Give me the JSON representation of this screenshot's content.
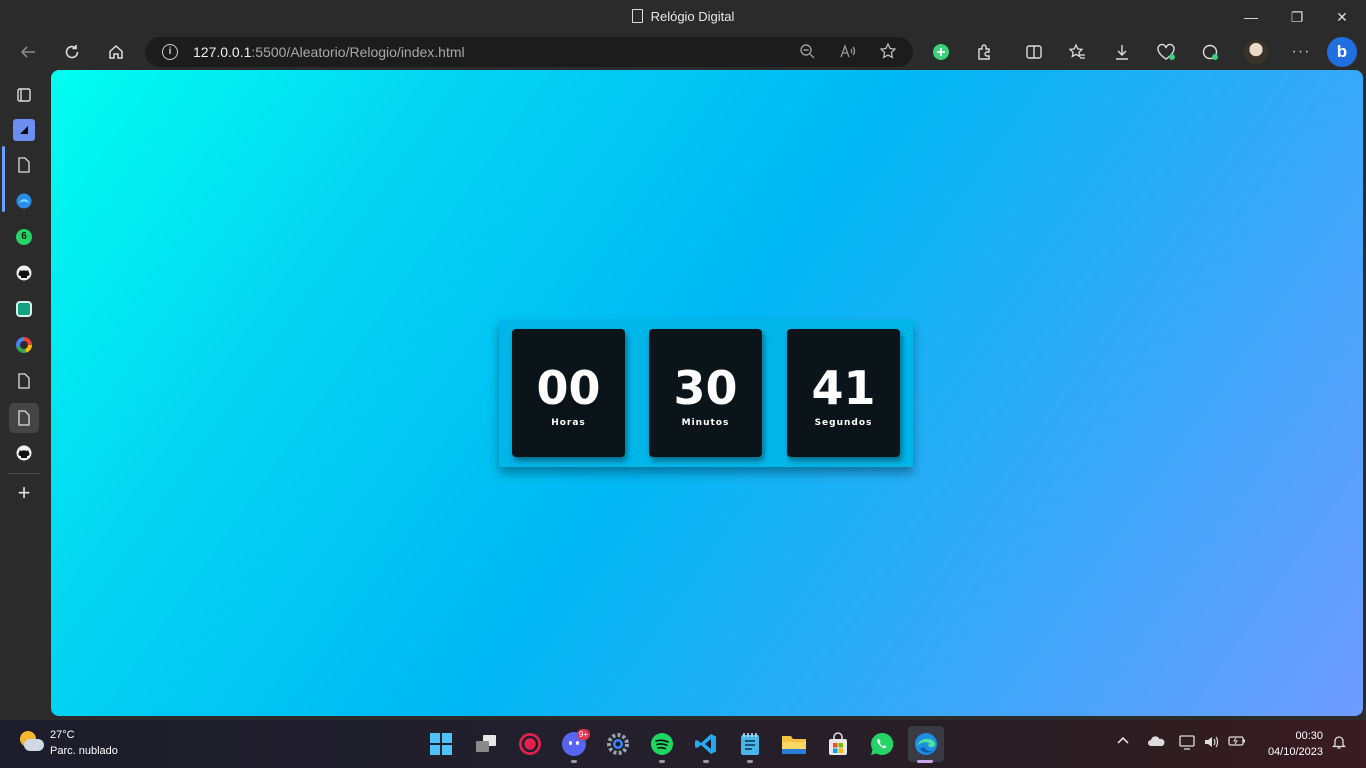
{
  "window": {
    "title": "Relógio Digital",
    "minimize_glyph": "—",
    "restore_glyph": "❐",
    "close_glyph": "✕"
  },
  "toolbar": {
    "url_host": "127.0.0.1",
    "url_rest": ":5500/Aleatorio/Relogio/index.html",
    "icons": [
      "back-icon",
      "refresh-icon",
      "home-icon",
      "info-icon",
      "zoom-out-icon",
      "read-aloud-icon",
      "favorite-star-icon",
      "add-icon",
      "extensions-icon",
      "split-screen-icon",
      "favorites-icon",
      "downloads-icon",
      "health-icon",
      "copilot-icon",
      "profile-avatar",
      "more-icon",
      "bing-icon"
    ]
  },
  "sidebar": {
    "items": [
      "tab-actions-icon",
      "tab-icon",
      "page-icon",
      "edge-tab-icon",
      "whatsapp-icon",
      "github-icon",
      "chatgpt-icon",
      "google-icon",
      "page-icon",
      "page-icon",
      "github-icon",
      "add-icon"
    ],
    "whatsapp_count": "6",
    "add_glyph": "+"
  },
  "clock": {
    "hours": "00",
    "hours_label": "Horas",
    "minutes": "30",
    "minutes_label": "Minutos",
    "seconds": "41",
    "seconds_label": "Segundos"
  },
  "taskbar": {
    "weather_temp": "27°C",
    "weather_condition": "Parc. nublado",
    "apps": [
      "windows-start-icon",
      "task-view-icon",
      "recorder-icon",
      "discord-icon",
      "settings-icon",
      "spotify-icon",
      "vscode-icon",
      "notepad-icon",
      "file-explorer-icon",
      "store-icon",
      "whatsapp-icon",
      "edge-icon"
    ],
    "discord_badge": "9+",
    "time": "00:30",
    "date": "04/10/2023"
  },
  "colors": {
    "accent": "#6aa0ff",
    "clock_card": "#0a1419",
    "clock_frame": "#00b6e9",
    "gradient_start": "#00fff0",
    "gradient_end": "#6f9bff"
  }
}
